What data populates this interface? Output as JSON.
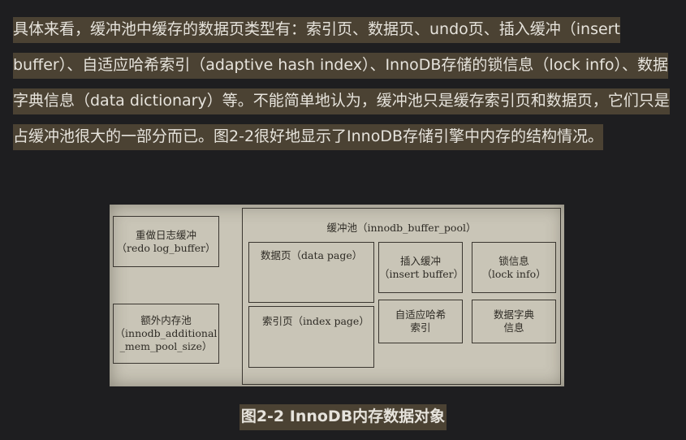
{
  "paragraph": {
    "text": "具体来看，缓冲池中缓存的数据页类型有：索引页、数据页、undo页、插入缓冲（insert buffer）、自适应哈希索引（adaptive hash index）、InnoDB存储的锁信息（lock info）、数据字典信息（data dictionary）等。不能简单地认为，缓冲池只是缓存索引页和数据页，它们只是占缓冲池很大的一部分而已。图2-2很好地显示了InnoDB存储引擎中内存的结构情况。"
  },
  "figure": {
    "redo_log_buffer": {
      "title": "重做日志缓冲",
      "sub": "（redo log_buffer）"
    },
    "additional_mem_pool": {
      "title": "额外内存池",
      "sub1": "（innodb_additional",
      "sub2": "_mem_pool_size）"
    },
    "buffer_pool": {
      "title": "缓冲池（innodb_buffer_pool）"
    },
    "data_page": {
      "label": "数据页（data page）"
    },
    "index_page": {
      "label": "索引页（index page）"
    },
    "insert_buffer": {
      "title": "插入缓冲",
      "sub": "（insert buffer）"
    },
    "lock_info": {
      "title": "锁信息",
      "sub": "（lock info）"
    },
    "adaptive_hash_index": {
      "line1": "自适应哈希",
      "line2": "索引"
    },
    "data_dictionary": {
      "line1": "数据字典",
      "line2": "信息"
    }
  },
  "caption": "图2-2 InnoDB内存数据对象",
  "colors": {
    "background": "#1e1e20",
    "highlight": "#4b4233",
    "text": "#e6e3dc",
    "figure_bg": "#c9c5b7"
  }
}
